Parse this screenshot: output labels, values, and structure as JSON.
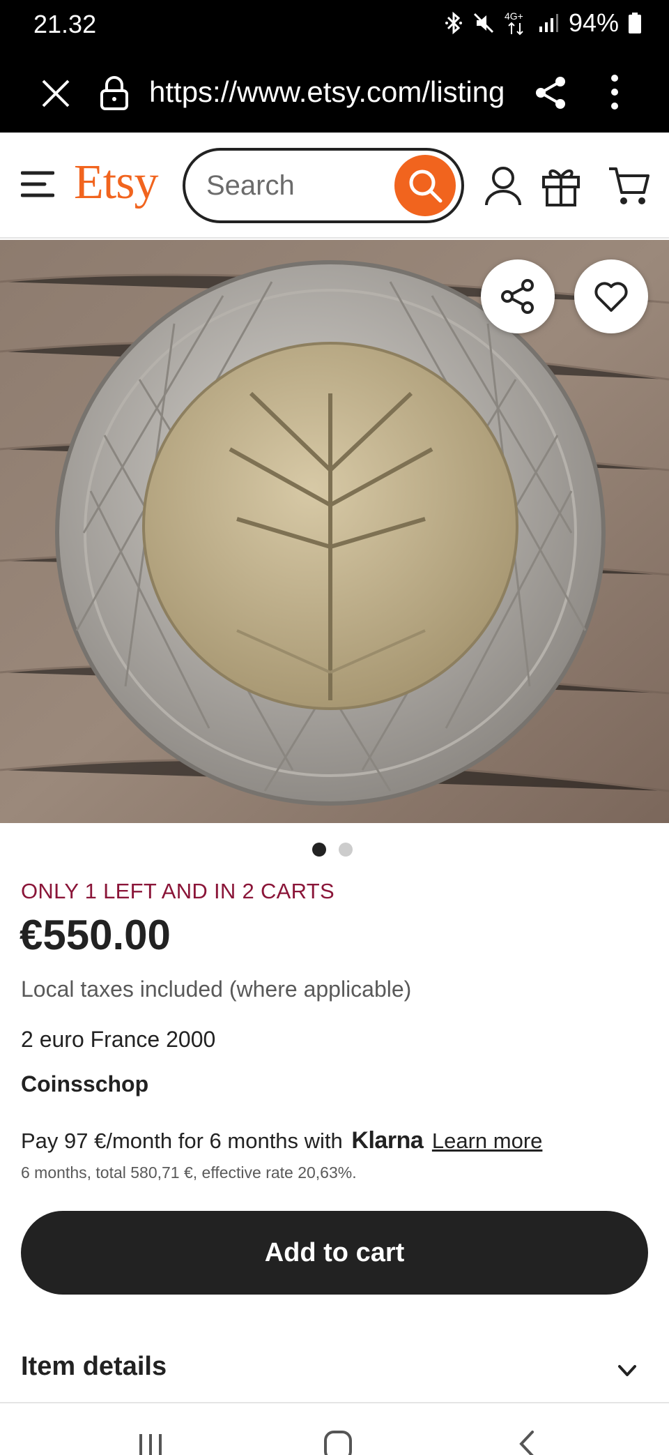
{
  "status_bar": {
    "time": "21.32",
    "network": "4G+",
    "battery": "94%",
    "icons": [
      "bluetooth-icon",
      "mute-icon",
      "network-icon",
      "signal-icon",
      "battery-icon"
    ]
  },
  "browser": {
    "url": "https://www.etsy.com/listing",
    "icons": [
      "close-icon",
      "lock-icon",
      "share-icon",
      "more-icon"
    ]
  },
  "header": {
    "logo": "Etsy",
    "search_placeholder": "Search",
    "icons": [
      "menu-icon",
      "search-icon",
      "account-icon",
      "gift-icon",
      "cart-icon"
    ]
  },
  "gallery": {
    "image_count": 2,
    "active_index": 0
  },
  "product": {
    "scarcity": "ONLY 1 LEFT AND IN 2 CARTS",
    "price": "€550.00",
    "taxes_note": "Local taxes included (where applicable)",
    "title": "2 euro France 2000",
    "shop": "Coinsschop"
  },
  "financing": {
    "prefix": "Pay 97 €/month for 6 months with",
    "provider": "Klarna",
    "link": "Learn more",
    "detail": "6 months, total 580,71 €, effective rate 20,63%."
  },
  "actions": {
    "add_to_cart": "Add to cart"
  },
  "sections": {
    "item_details": "Item details"
  },
  "colors": {
    "brand": "#f1641e",
    "scarcity": "#8a1538",
    "button": "#222222"
  }
}
